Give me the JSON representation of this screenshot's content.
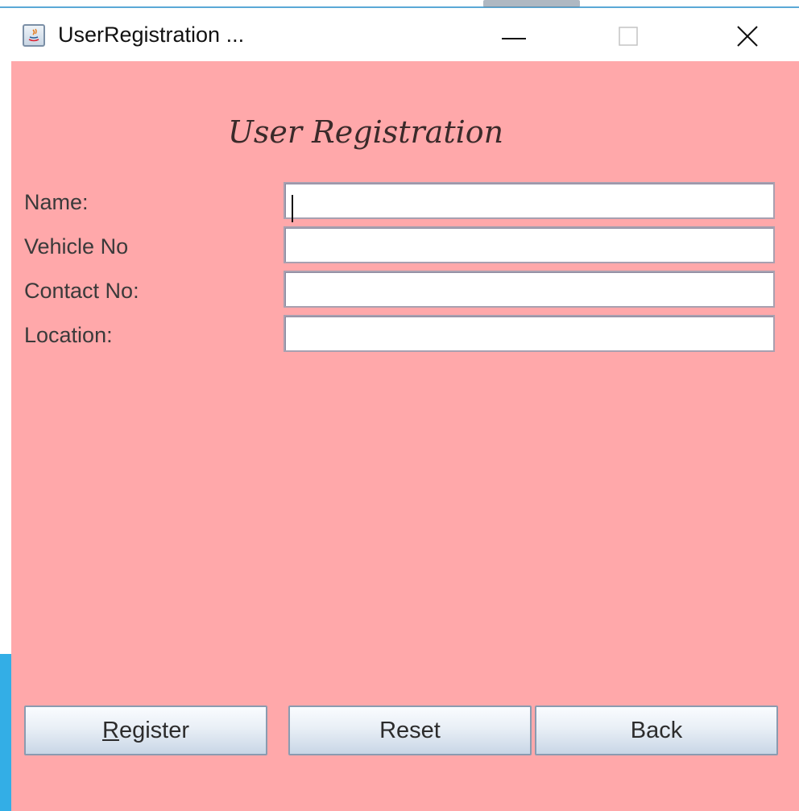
{
  "window": {
    "title": "UserRegistration ..."
  },
  "form": {
    "heading": "User Registration",
    "fields": [
      {
        "label": "Name:",
        "value": ""
      },
      {
        "label": "Vehicle No",
        "value": ""
      },
      {
        "label": "Contact No:",
        "value": ""
      },
      {
        "label": "Location:",
        "value": ""
      }
    ]
  },
  "buttons": {
    "register_mnemonic": "R",
    "register_rest": "egister",
    "reset": "Reset",
    "back": "Back"
  },
  "colors": {
    "panel_background": "#ffa8aa",
    "accent": "#33aee6"
  },
  "icons": {
    "app_icon": "java-app-icon",
    "minimize": "minimize-icon",
    "maximize": "maximize-icon",
    "close": "close-icon"
  }
}
